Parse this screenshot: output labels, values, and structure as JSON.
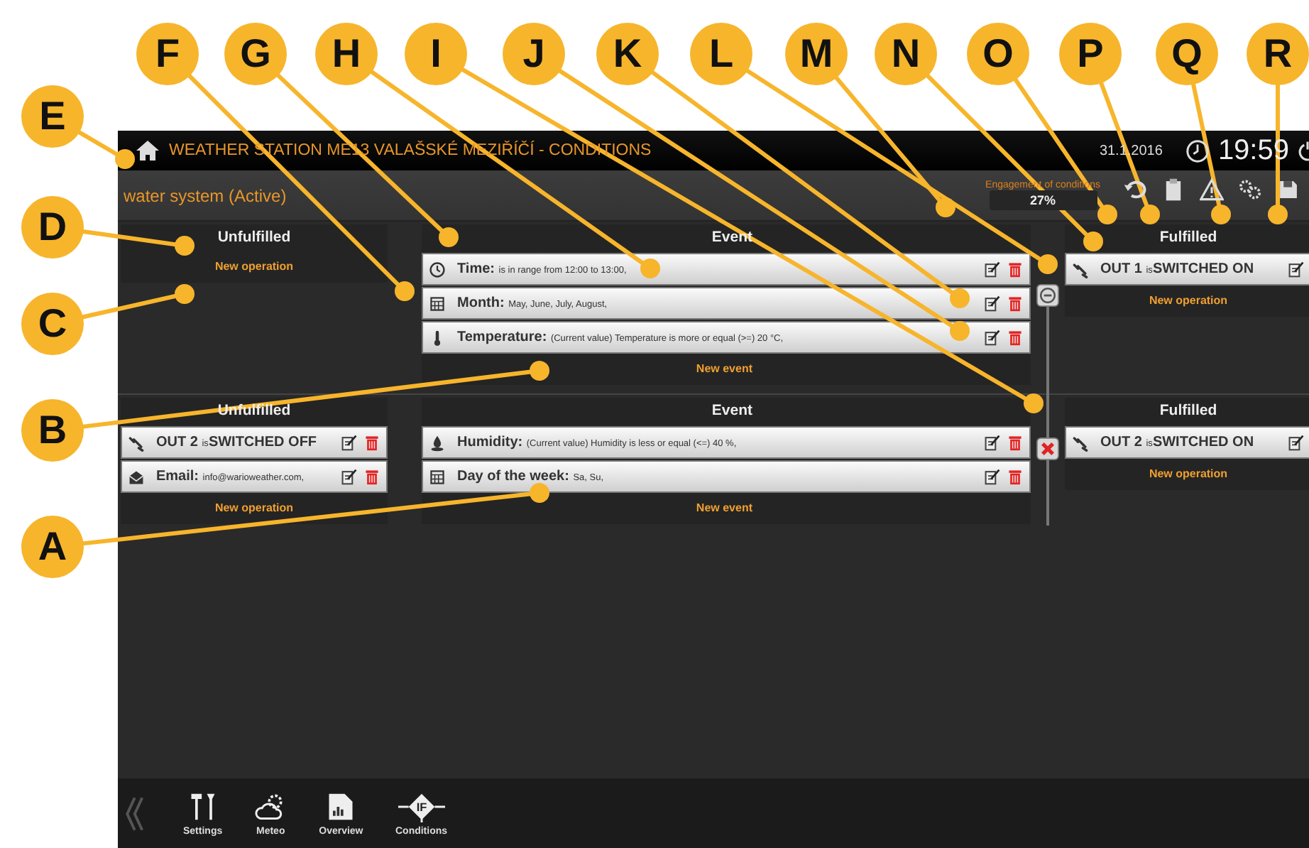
{
  "callouts": [
    {
      "letter": "F"
    },
    {
      "letter": "G"
    },
    {
      "letter": "H"
    },
    {
      "letter": "I"
    },
    {
      "letter": "J"
    },
    {
      "letter": "K"
    },
    {
      "letter": "L"
    },
    {
      "letter": "M"
    },
    {
      "letter": "N"
    },
    {
      "letter": "O"
    },
    {
      "letter": "P"
    },
    {
      "letter": "Q"
    },
    {
      "letter": "R"
    },
    {
      "letter": "E"
    },
    {
      "letter": "D"
    },
    {
      "letter": "C"
    },
    {
      "letter": "B"
    },
    {
      "letter": "A"
    }
  ],
  "header": {
    "title": "WEATHER STATION ME13  VALAŠSKÉ MEZIŘÍČÍ - CONDITIONS",
    "date": "31.1.2016",
    "time": "19:59"
  },
  "subheader": {
    "name": "water system (Active)",
    "engagement_label": "Engagement of conditions",
    "engagement_value": "27%"
  },
  "sections": [
    {
      "unfulfilled": {
        "title": "Unfulfilled",
        "add": "New operation"
      },
      "event": {
        "title": "Event",
        "add": "New event",
        "rows": [
          {
            "kind": "time",
            "label": "Time:",
            "detail": "is in range from 12:00 to 13:00,"
          },
          {
            "kind": "month",
            "label": "Month:",
            "detail": "May, June, July, August,"
          },
          {
            "kind": "temperature",
            "label": "Temperature:",
            "detail": "(Current value) Temperature is more or equal (>=) 20 °C,"
          }
        ]
      },
      "joint": {
        "kind": "remove"
      },
      "fulfilled": {
        "title": "Fulfilled",
        "add": "New operation",
        "rows": [
          {
            "kind": "output",
            "label": "OUT 1",
            "detail": "is",
            "value": "SWITCHED ON"
          }
        ]
      }
    },
    {
      "unfulfilled": {
        "title": "Unfulfilled",
        "add": "New operation",
        "rows": [
          {
            "kind": "output",
            "label": "OUT 2",
            "detail": "is",
            "value": "SWITCHED OFF"
          },
          {
            "kind": "email",
            "label": "Email:",
            "detail": "info@warioweather.com,"
          }
        ]
      },
      "event": {
        "title": "Event",
        "add": "New event",
        "rows": [
          {
            "kind": "humidity",
            "label": "Humidity:",
            "detail": "(Current value) Humidity is less or equal (<=) 40 %,"
          },
          {
            "kind": "weekday",
            "label": "Day of the week:",
            "detail": "Sa, Su,"
          }
        ]
      },
      "joint": {
        "kind": "invalid"
      },
      "fulfilled": {
        "title": "Fulfilled",
        "add": "New operation",
        "rows": [
          {
            "kind": "output",
            "label": "OUT 2",
            "detail": "is",
            "value": "SWITCHED ON"
          }
        ]
      }
    }
  ],
  "nav": [
    {
      "kind": "settings",
      "label": "Settings"
    },
    {
      "kind": "meteo",
      "label": "Meteo"
    },
    {
      "kind": "overview",
      "label": "Overview"
    },
    {
      "kind": "conditions",
      "label": "Conditions",
      "icon_text": "IF"
    }
  ]
}
